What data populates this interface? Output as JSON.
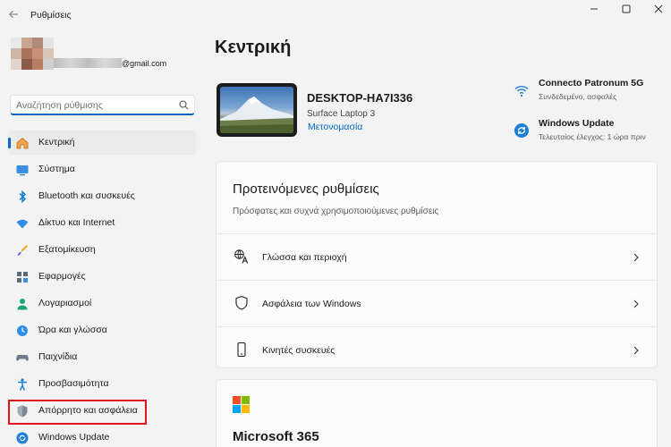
{
  "window": {
    "app_title": "Ρυθμίσεις",
    "back_icon": "arrow-left-icon",
    "controls": [
      "minimize-icon",
      "maximize-icon",
      "close-icon"
    ]
  },
  "account": {
    "email_suffix": "@gmail.com"
  },
  "search": {
    "placeholder": "Αναζήτηση ρύθμισης",
    "value": ""
  },
  "sidebar": {
    "items": [
      {
        "label": "Κεντρική",
        "icon": "home-icon",
        "active": true
      },
      {
        "label": "Σύστημα",
        "icon": "monitor-icon"
      },
      {
        "label": "Bluetooth και συσκευές",
        "icon": "bluetooth-icon"
      },
      {
        "label": "Δίκτυο και Internet",
        "icon": "wifi-icon"
      },
      {
        "label": "Εξατομίκευση",
        "icon": "brush-icon"
      },
      {
        "label": "Εφαρμογές",
        "icon": "apps-icon"
      },
      {
        "label": "Λογαριασμοί",
        "icon": "person-icon"
      },
      {
        "label": "Ώρα και γλώσσα",
        "icon": "clock-globe-icon"
      },
      {
        "label": "Παιχνίδια",
        "icon": "gamepad-icon"
      },
      {
        "label": "Προσβασιμότητα",
        "icon": "accessibility-icon"
      },
      {
        "label": "Απόρρητο και ασφάλεια",
        "icon": "shield-icon",
        "highlighted": true
      },
      {
        "label": "Windows Update",
        "icon": "update-icon"
      }
    ]
  },
  "main": {
    "title": "Κεντρική",
    "device": {
      "name": "DESKTOP-HA7I336",
      "model": "Surface Laptop 3",
      "rename_label": "Μετονομασία"
    },
    "status": [
      {
        "title": "Connecto Patronum 5G",
        "subtitle": "Συνδεδεμένο, ασφαλές",
        "icon": "wifi-icon"
      },
      {
        "title": "Windows Update",
        "subtitle": "Τελευταίος έλεγχος: 1 ώρα πριν",
        "icon": "update-icon"
      }
    ],
    "recommended": {
      "title": "Προτεινόμενες ρυθμίσεις",
      "subtitle": "Πρόσφατες και συχνά χρησιμοποιούμενες ρυθμίσεις",
      "rows": [
        {
          "label": "Γλώσσα και περιοχή",
          "icon": "language-icon"
        },
        {
          "label": "Ασφάλεια των Windows",
          "icon": "shield-outline-icon"
        },
        {
          "label": "Κινητές συσκευές",
          "icon": "phone-icon"
        }
      ]
    },
    "microsoft365": {
      "title": "Microsoft 365",
      "logo": "microsoft-logo-icon"
    }
  },
  "colors": {
    "accent": "#0067c0",
    "highlight_border": "#e0141e",
    "background": "#f3f3f3",
    "card": "#fbfbfb"
  }
}
